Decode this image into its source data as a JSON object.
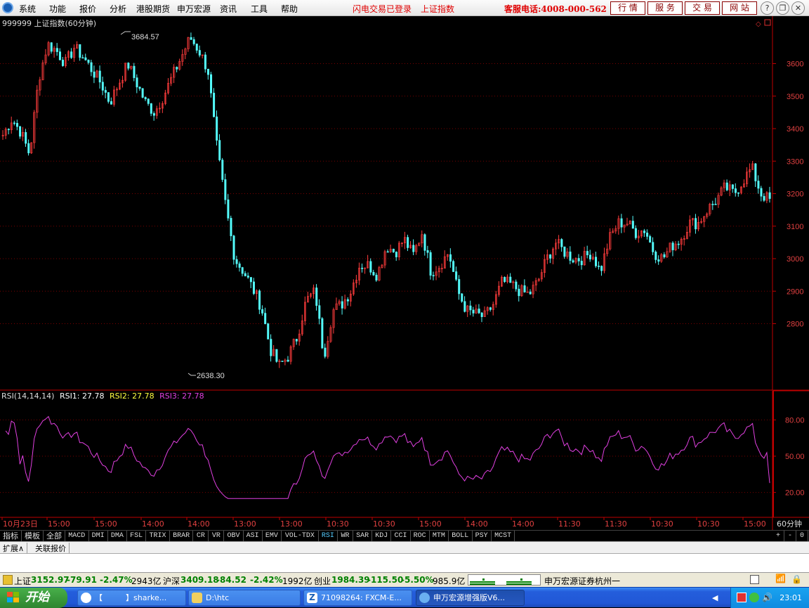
{
  "menubar": {
    "items": [
      "系统",
      "功能",
      "报价",
      "分析",
      "港股期货",
      "申万宏源",
      "资讯",
      "工具",
      "帮助"
    ],
    "login_status": "闪电交易已登录",
    "current_index": "上证指数",
    "hotline": "客服电话:4008-000-562",
    "tab_buttons": [
      "行 情",
      "服 务",
      "交 易",
      "网 站"
    ],
    "window_buttons": [
      "help-icon",
      "restore-icon",
      "close-icon"
    ]
  },
  "chart": {
    "title": "999999 上证指数(60分钟)",
    "high_label": "3684.57",
    "low_label": "2638.30",
    "corner_icons": [
      "diamond-icon",
      "square-icon"
    ],
    "price_axis": [
      "3600",
      "3500",
      "3400",
      "3300",
      "3200",
      "3100",
      "3000",
      "2900",
      "2800"
    ],
    "rsi_axis": [
      "80.00",
      "50.00",
      "20.00"
    ],
    "time_axis": [
      "10月23日",
      "15:00",
      "15:00",
      "14:00",
      "14:00",
      "13:00",
      "13:00",
      "10:30",
      "10:30",
      "15:00",
      "14:00",
      "14:00",
      "11:30",
      "11:30",
      "10:30",
      "10:30",
      "15:00"
    ],
    "period_label": "60分钟"
  },
  "chart_data": [
    {
      "type": "candlestick",
      "title": "999999 上证指数(60分钟)",
      "ylim": [
        2600,
        3720
      ],
      "annotations": [
        {
          "label": "3684.57",
          "value": 3684.57
        },
        {
          "label": "2638.30",
          "value": 2638.3
        }
      ],
      "closes_approx": [
        3380,
        3430,
        3390,
        3320,
        3550,
        3660,
        3640,
        3600,
        3650,
        3620,
        3580,
        3540,
        3480,
        3540,
        3600,
        3540,
        3480,
        3450,
        3500,
        3560,
        3620,
        3680,
        3640,
        3580,
        3340,
        3160,
        3000,
        2960,
        2910,
        2850,
        2720,
        2670,
        2700,
        2760,
        2870,
        2900,
        2700,
        2840,
        2860,
        2900,
        2980,
        2980,
        2950,
        3040,
        3020,
        3060,
        3010,
        3080,
        2960,
        2980,
        3020,
        2900,
        2840,
        2830,
        2820,
        2860,
        2930,
        2920,
        2900,
        2890,
        2930,
        3000,
        3050,
        3020,
        3000,
        3000,
        3020,
        2960,
        3060,
        3110,
        3110,
        3080,
        3090,
        3020,
        3000,
        3040,
        3060,
        3110,
        3110,
        3150,
        3180,
        3220,
        3200,
        3240,
        3280,
        3200,
        3180
      ]
    },
    {
      "type": "line",
      "title": "RSI(14,14,14)",
      "series": [
        {
          "name": "RSI1",
          "last": 27.78
        },
        {
          "name": "RSI2",
          "last": 27.78
        },
        {
          "name": "RSI3",
          "last": 27.78
        }
      ],
      "ylim": [
        0,
        100
      ],
      "ticks": [
        20,
        50,
        80
      ]
    }
  ],
  "rsi_legend": {
    "name": "RSI(14,14,14)",
    "rsi1": "RSI1: 27.78",
    "rsi2": "RSI2: 27.78",
    "rsi3": "RSI3: 27.78"
  },
  "toolbar": {
    "buttons": [
      "指标",
      "模板",
      "全部",
      "MACD",
      "DMI",
      "DMA",
      "FSL",
      "TRIX",
      "BRAR",
      "CR",
      "VR",
      "OBV",
      "ASI",
      "EMV",
      "VOL-TDX",
      "RSI",
      "WR",
      "SAR",
      "KDJ",
      "CCI",
      "ROC",
      "MTM",
      "BOLL",
      "PSY",
      "MCST"
    ],
    "active": "RSI",
    "right_buttons": [
      "+",
      "-",
      "0"
    ]
  },
  "extra_tabs": [
    "扩展∧",
    "关联报价"
  ],
  "ticker": {
    "sh_label": "上证",
    "sh_value": "3152.97",
    "sh_change": "-79.91",
    "sh_pct": "-2.47%",
    "sh_amount": "2943亿",
    "hs_label": "沪深",
    "hs_value": "3409.18",
    "hs_change": "-84.52",
    "hs_pct": "-2.42%",
    "hs_amount": "1992亿",
    "cy_label": "创业",
    "cy_value": "1984.39",
    "cy_change": "-115.50",
    "cy_pct": "-5.50%",
    "cy_amount": "985.9亿",
    "broker": "申万宏源证券杭州一"
  },
  "taskbar": {
    "start": "开始",
    "tasks": [
      "【　　　】sharke...",
      "D:\\htc",
      "71098264: FXCM-E...",
      "申万宏源增强版V6..."
    ],
    "clock": "23:01"
  }
}
